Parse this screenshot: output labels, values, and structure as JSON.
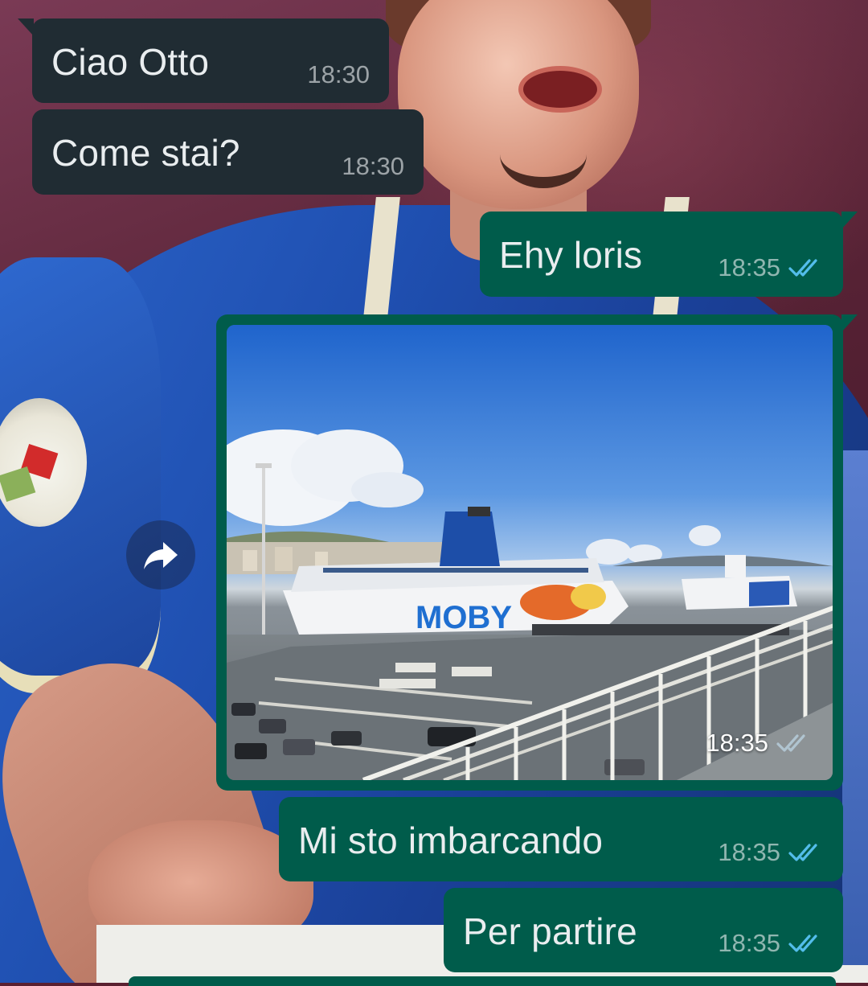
{
  "chat": {
    "messages": [
      {
        "direction": "incoming",
        "text": "Ciao Otto",
        "time": "18:30"
      },
      {
        "direction": "incoming",
        "text": "Come stai?",
        "time": "18:30"
      },
      {
        "direction": "outgoing",
        "text": "Ehy loris",
        "time": "18:35",
        "status": "read"
      },
      {
        "direction": "outgoing",
        "type": "image",
        "time": "18:35",
        "status": "delivered",
        "image_text": "MOBY"
      },
      {
        "direction": "outgoing",
        "text": "Mi sto imbarcando",
        "time": "18:35",
        "status": "read"
      },
      {
        "direction": "outgoing",
        "text": "Per partire",
        "time": "18:35",
        "status": "read"
      }
    ]
  },
  "icons": {
    "forward": "forward-arrow-icon",
    "read_receipt": "double-check-icon"
  },
  "colors": {
    "incoming_bubble": "#202c33",
    "outgoing_bubble": "#005c4b",
    "read_tick": "#53bdeb",
    "delivered_tick": "#b0c4d0"
  }
}
